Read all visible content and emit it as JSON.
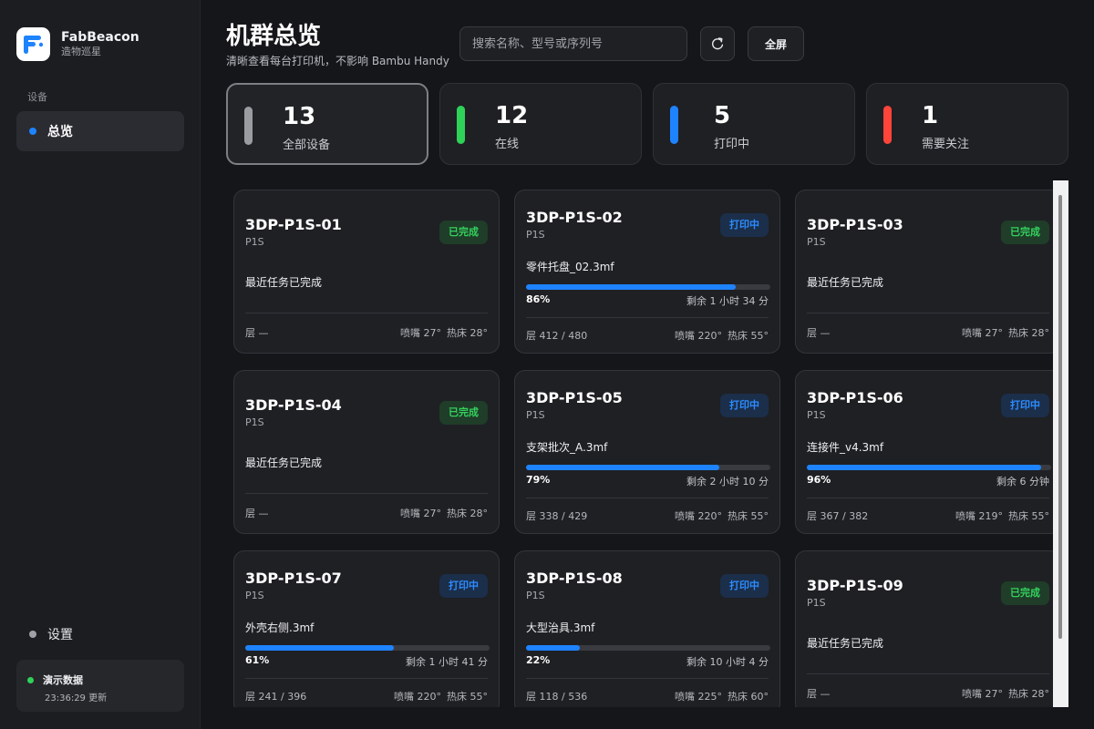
{
  "brand": {
    "name": "FabBeacon",
    "subtitle": "造物巡星"
  },
  "sidebar": {
    "section_label": "设备",
    "nav_overview": "总览",
    "settings_label": "设置",
    "demo": {
      "title": "演示数据",
      "time": "23:36:29 更新"
    }
  },
  "header": {
    "title": "机群总览",
    "subtitle": "清晰查看每台打印机，不影响 Bambu Handy",
    "search_placeholder": "搜索名称、型号或序列号",
    "refresh_icon": "refresh-icon",
    "fullscreen_label": "全屏"
  },
  "stats": [
    {
      "value": "13",
      "label": "全部设备",
      "color": "#9a9ca1"
    },
    {
      "value": "12",
      "label": "在线",
      "color": "#2fd158"
    },
    {
      "value": "5",
      "label": "打印中",
      "color": "#1e83ff"
    },
    {
      "value": "1",
      "label": "需要关注",
      "color": "#ff453a"
    }
  ],
  "printers": [
    {
      "name": "3DP-P1S-01",
      "model": "P1S",
      "status": "已完成",
      "state": "done",
      "recent": "最近任务已完成",
      "layer": "层 —",
      "nozzle": "喷嘴 27°",
      "bed": "热床 28°"
    },
    {
      "name": "3DP-P1S-02",
      "model": "P1S",
      "status": "打印中",
      "state": "printing",
      "file": "零件托盘_02.3mf",
      "progress": 0.86,
      "pct": "86%",
      "remaining": "剩余 1 小时 34 分",
      "layer": "层 412 / 480",
      "nozzle": "喷嘴 220°",
      "bed": "热床 55°"
    },
    {
      "name": "3DP-P1S-03",
      "model": "P1S",
      "status": "已完成",
      "state": "done",
      "recent": "最近任务已完成",
      "layer": "层 —",
      "nozzle": "喷嘴 27°",
      "bed": "热床 28°"
    },
    {
      "name": "3DP-P1S-04",
      "model": "P1S",
      "status": "已完成",
      "state": "done",
      "recent": "最近任务已完成",
      "layer": "层 —",
      "nozzle": "喷嘴 27°",
      "bed": "热床 28°"
    },
    {
      "name": "3DP-P1S-05",
      "model": "P1S",
      "status": "打印中",
      "state": "printing",
      "file": "支架批次_A.3mf",
      "progress": 0.79,
      "pct": "79%",
      "remaining": "剩余 2 小时 10 分",
      "layer": "层 338 / 429",
      "nozzle": "喷嘴 220°",
      "bed": "热床 55°"
    },
    {
      "name": "3DP-P1S-06",
      "model": "P1S",
      "status": "打印中",
      "state": "printing",
      "file": "连接件_v4.3mf",
      "progress": 0.96,
      "pct": "96%",
      "remaining": "剩余 6 分钟",
      "layer": "层 367 / 382",
      "nozzle": "喷嘴 219°",
      "bed": "热床 55°"
    },
    {
      "name": "3DP-P1S-07",
      "model": "P1S",
      "status": "打印中",
      "state": "printing",
      "file": "外壳右侧.3mf",
      "progress": 0.61,
      "pct": "61%",
      "remaining": "剩余 1 小时 41 分",
      "layer": "层 241 / 396",
      "nozzle": "喷嘴 220°",
      "bed": "热床 55°"
    },
    {
      "name": "3DP-P1S-08",
      "model": "P1S",
      "status": "打印中",
      "state": "printing",
      "file": "大型治具.3mf",
      "progress": 0.22,
      "pct": "22%",
      "remaining": "剩余 10 小时 4 分",
      "layer": "层 118 / 536",
      "nozzle": "喷嘴 225°",
      "bed": "热床 60°"
    },
    {
      "name": "3DP-P1S-09",
      "model": "P1S",
      "status": "已完成",
      "state": "done",
      "recent": "最近任务已完成",
      "layer": "层 —",
      "nozzle": "喷嘴 27°",
      "bed": "热床 28°"
    }
  ]
}
